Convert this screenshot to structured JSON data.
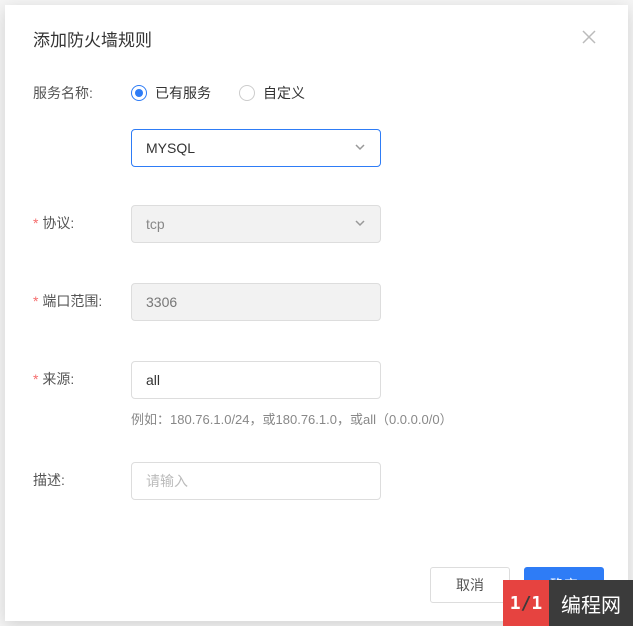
{
  "modal": {
    "title": "添加防火墙规则"
  },
  "form": {
    "service_label": "服务名称:",
    "radio_existing": "已有服务",
    "radio_custom": "自定义",
    "service_select_value": "MYSQL",
    "protocol_label": "协议:",
    "protocol_value": "tcp",
    "port_label": "端口范围:",
    "port_value": "3306",
    "source_label": "来源:",
    "source_value": "all",
    "source_hint": "例如：180.76.1.0/24，或180.76.1.0，或all（0.0.0.0/0）",
    "desc_label": "描述:",
    "desc_placeholder": "请输入"
  },
  "footer": {
    "cancel": "取消",
    "confirm": "确定"
  },
  "brand": {
    "text": "编程网"
  }
}
